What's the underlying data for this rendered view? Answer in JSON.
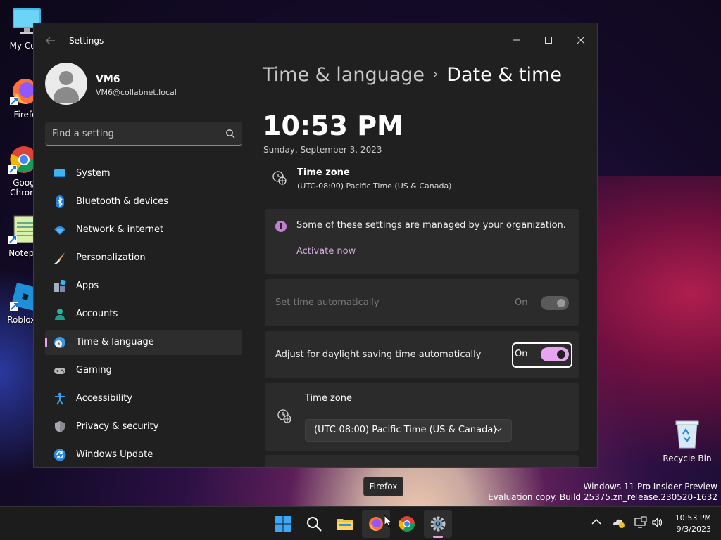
{
  "desktop": {
    "icons": [
      {
        "label": "My Com",
        "icon": "monitor-icon"
      },
      {
        "label": "Firefo",
        "icon": "firefox-icon"
      },
      {
        "label": "Goog\nChrom",
        "label_line1": "Goog",
        "label_line2": "Chrom",
        "icon": "chrome-icon"
      },
      {
        "label": "Notepa",
        "icon": "notepad-icon"
      },
      {
        "label": "Roblox S",
        "icon": "roblox-icon"
      }
    ],
    "recycle_bin": "Recycle Bin",
    "watermark_line1": "Windows 11 Pro Insider Preview",
    "watermark_line2": "Evaluation copy. Build 25375.zn_release.230520-1632"
  },
  "window": {
    "title": "Settings",
    "controls": {
      "minimize": "—",
      "maximize": "☐",
      "close": "✕"
    }
  },
  "profile": {
    "name": "VM6",
    "email": "VM6@collabnet.local"
  },
  "search": {
    "placeholder": "Find a setting"
  },
  "nav": {
    "items": [
      {
        "label": "System",
        "icon": "system-icon"
      },
      {
        "label": "Bluetooth & devices",
        "icon": "bluetooth-icon"
      },
      {
        "label": "Network & internet",
        "icon": "wifi-icon"
      },
      {
        "label": "Personalization",
        "icon": "brush-icon"
      },
      {
        "label": "Apps",
        "icon": "apps-icon"
      },
      {
        "label": "Accounts",
        "icon": "accounts-icon"
      },
      {
        "label": "Time & language",
        "icon": "globe-clock-icon",
        "selected": true
      },
      {
        "label": "Gaming",
        "icon": "gamepad-icon"
      },
      {
        "label": "Accessibility",
        "icon": "accessibility-icon"
      },
      {
        "label": "Privacy & security",
        "icon": "shield-icon"
      },
      {
        "label": "Windows Update",
        "icon": "update-icon"
      }
    ]
  },
  "content": {
    "breadcrumb_parent": "Time & language",
    "breadcrumb_separator": "›",
    "breadcrumb_current": "Date & time",
    "time": "10:53 PM",
    "date": "Sunday, September 3, 2023",
    "timezone_summary_title": "Time zone",
    "timezone_summary_value": "(UTC-08:00) Pacific Time (US & Canada)",
    "managed_message": "Some of these settings are managed by your organization.",
    "activate_link": "Activate now",
    "set_time_auto_label": "Set time automatically",
    "set_time_auto_state": "On",
    "dst_label": "Adjust for daylight saving time automatically",
    "dst_state": "On",
    "timezone_card_title": "Time zone",
    "timezone_select_value": "(UTC-08:00) Pacific Time (US & Canada)"
  },
  "tooltip": "Firefox",
  "taskbar": {
    "apps": [
      "start-icon",
      "search-icon",
      "file-explorer-icon",
      "firefox-icon",
      "chrome-icon",
      "settings-icon"
    ],
    "clock_time": "10:53 PM",
    "clock_date": "9/3/2023"
  },
  "colors": {
    "accent": "#e6a0e8",
    "window_bg": "#202020",
    "card_bg": "#2b2b2b"
  }
}
